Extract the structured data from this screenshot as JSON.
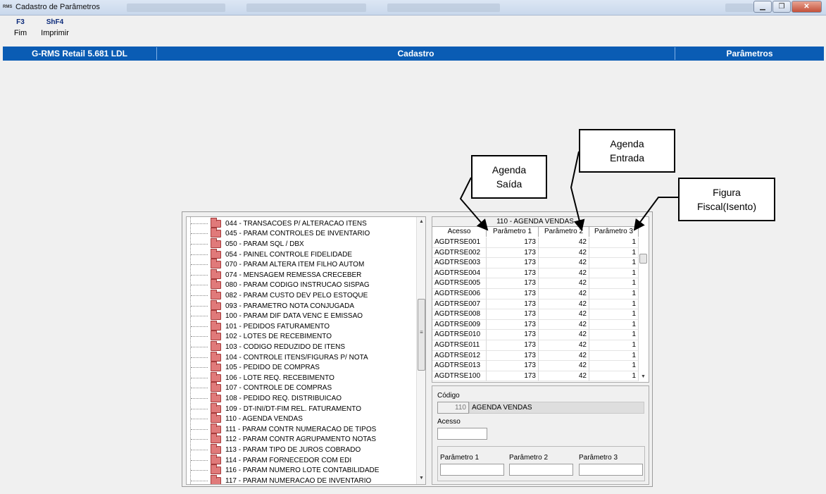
{
  "window": {
    "title": "Cadastro de Parâmetros",
    "app_icon": "rms-logo-icon",
    "controls": [
      "minimize-icon",
      "restore-icon",
      "close-icon"
    ],
    "close_glyph": "✕",
    "min_glyph": "▁",
    "restore_glyph": "❐"
  },
  "fkeys": [
    {
      "key": "F3",
      "label": "Fim"
    },
    {
      "key": "ShF4",
      "label": "Imprimir"
    }
  ],
  "header": {
    "system": "G-RMS Retail 5.681 LDL",
    "module": "Cadastro",
    "screen": "Parâmetros"
  },
  "callouts": [
    {
      "text_line1": "Agenda",
      "text_line2": "Saída"
    },
    {
      "text_line1": "Agenda",
      "text_line2": "Entrada"
    },
    {
      "text_line1": "Figura",
      "text_line2": "Fiscal(Isento)"
    }
  ],
  "tree": {
    "items": [
      "044 - TRANSACOES P/ ALTERACAO ITENS",
      "045 - PARAM CONTROLES DE INVENTARIO",
      "050 - PARAM SQL / DBX",
      "054 - PAINEL CONTROLE FIDELIDADE",
      "070 - PARAM ALTERA ITEM FILHO AUTOM",
      "074 - MENSAGEM REMESSA CRECEBER",
      "080 - PARAM CODIGO INSTRUCAO SISPAG",
      "082 - PARAM CUSTO DEV PELO ESTOQUE",
      "093 - PARAMETRO NOTA CONJUGADA",
      "100 - PARAM DIF DATA VENC E EMISSAO",
      "101 - PEDIDOS FATURAMENTO",
      "102 - LOTES DE RECEBIMENTO",
      "103 - CODIGO REDUZIDO DE ITENS",
      "104 - CONTROLE ITENS/FIGURAS P/ NOTA",
      "105 - PEDIDO DE COMPRAS",
      "106 - LOTE REQ. RECEBIMENTO",
      "107 - CONTROLE DE COMPRAS",
      "108 - PEDIDO REQ. DISTRIBUICAO",
      "109 - DT-INI/DT-FIM REL. FATURAMENTO",
      "110 - AGENDA VENDAS",
      "111 - PARAM CONTR NUMERACAO DE TIPOS",
      "112 - PARAM CONTR AGRUPAMENTO NOTAS",
      "113 - PARAM TIPO DE JUROS COBRADO",
      "114 - PARAM FORNECEDOR COM EDI",
      "116 - PARAM NUMERO LOTE CONTABILIDADE",
      "117 - PARAM NUMERACAO DE INVENTARIO"
    ],
    "scroll_up": "▲",
    "scroll_down": "▼",
    "scroll_grip": "≡"
  },
  "grid": {
    "title": "110 - AGENDA VENDAS",
    "columns": [
      "Acesso",
      "Parâmetro 1",
      "Parâmetro 2",
      "Parâmetro 3"
    ],
    "rows": [
      [
        "AGDTRSE001",
        "173",
        "42",
        "1"
      ],
      [
        "AGDTRSE002",
        "173",
        "42",
        "1"
      ],
      [
        "AGDTRSE003",
        "173",
        "42",
        "1"
      ],
      [
        "AGDTRSE004",
        "173",
        "42",
        "1"
      ],
      [
        "AGDTRSE005",
        "173",
        "42",
        "1"
      ],
      [
        "AGDTRSE006",
        "173",
        "42",
        "1"
      ],
      [
        "AGDTRSE007",
        "173",
        "42",
        "1"
      ],
      [
        "AGDTRSE008",
        "173",
        "42",
        "1"
      ],
      [
        "AGDTRSE009",
        "173",
        "42",
        "1"
      ],
      [
        "AGDTRSE010",
        "173",
        "42",
        "1"
      ],
      [
        "AGDTRSE011",
        "173",
        "42",
        "1"
      ],
      [
        "AGDTRSE012",
        "173",
        "42",
        "1"
      ],
      [
        "AGDTRSE013",
        "173",
        "42",
        "1"
      ],
      [
        "AGDTRSE100",
        "173",
        "42",
        "1"
      ]
    ],
    "scroll_down": "▼"
  },
  "form": {
    "codigo_label": "Código",
    "codigo_value": "110",
    "codigo_desc": "AGENDA VENDAS",
    "acesso_label": "Acesso",
    "acesso_value": "",
    "param1_label": "Parâmetro 1",
    "param2_label": "Parâmetro 2",
    "param3_label": "Parâmetro 3",
    "param1_value": "",
    "param2_value": "",
    "param3_value": ""
  }
}
